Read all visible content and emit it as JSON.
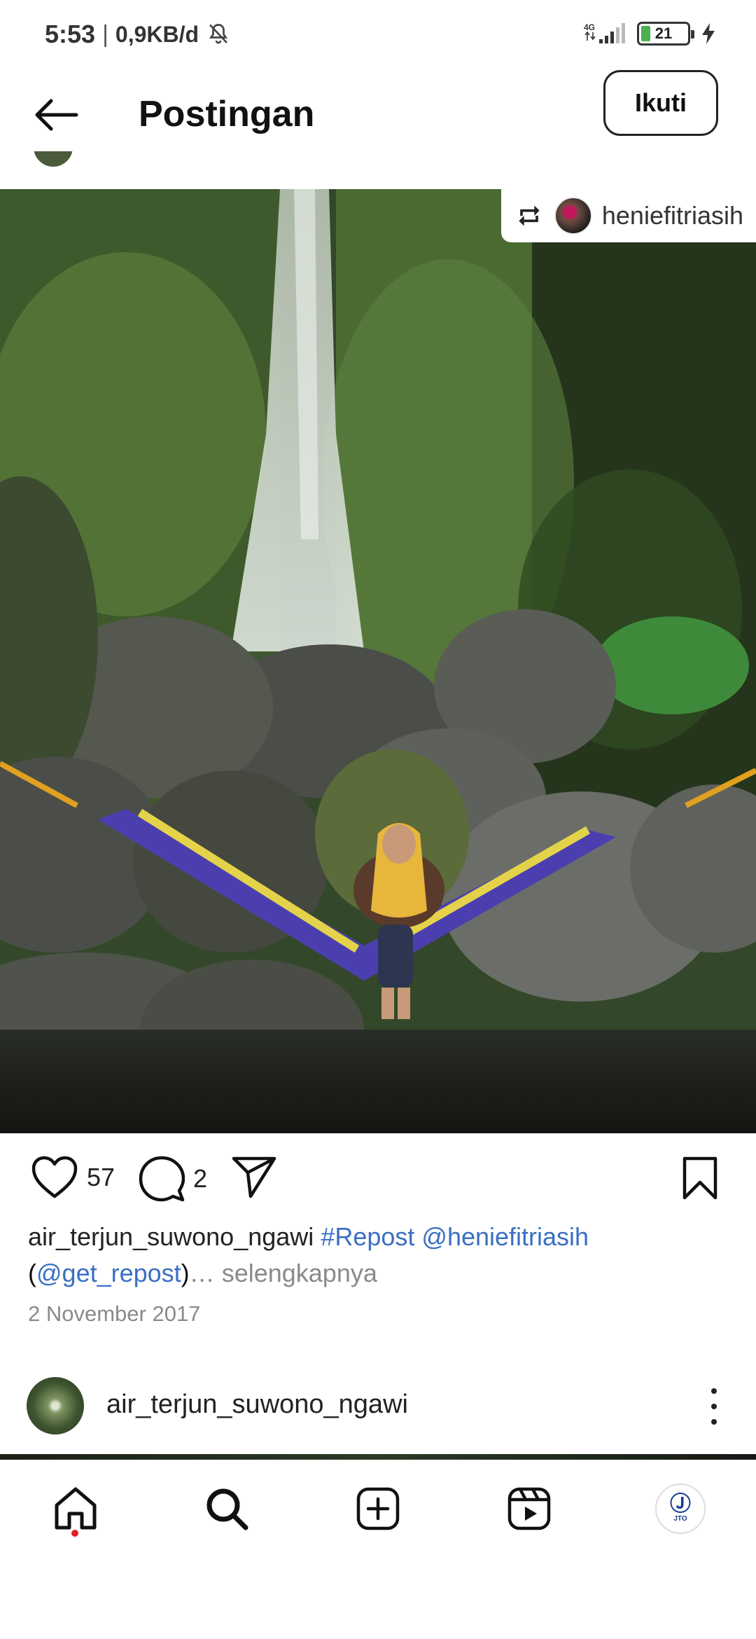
{
  "status_bar": {
    "time": "5:53",
    "separator": "|",
    "network_speed": "0,9KB/d",
    "network_type": "4G",
    "battery_level": "21",
    "battery_fraction": 0.21,
    "icons": [
      "mute-icon",
      "signal-icon",
      "battery-icon",
      "charging-icon"
    ]
  },
  "header": {
    "title": "Postingan",
    "follow_label": "Ikuti",
    "icons": [
      "back-arrow-icon"
    ]
  },
  "post": {
    "repost_username": "heniefitriasih",
    "image_description_icon": "repost-icon",
    "likes": "57",
    "comments": "2",
    "caption_user": "air_terjun_suwono_ngawi",
    "caption_hashtag": "#Repost",
    "caption_mention": "@heniefitriasih",
    "caption_open_paren": "(",
    "caption_mention2": "@get_repost",
    "caption_close": ")",
    "caption_ellipsis": "…",
    "caption_more": "selengkapnya",
    "date": "2 November 2017"
  },
  "next_post": {
    "username": "air_terjun_suwono_ngawi"
  },
  "bottom_nav": {
    "items": [
      "home-icon",
      "search-icon",
      "create-icon",
      "reels-icon",
      "profile-avatar"
    ],
    "profile_logo": "JTO",
    "accent": "#e02020"
  },
  "colors": {
    "link": "#3a6fc4",
    "muted": "#8a8a8a",
    "text": "#111111"
  }
}
